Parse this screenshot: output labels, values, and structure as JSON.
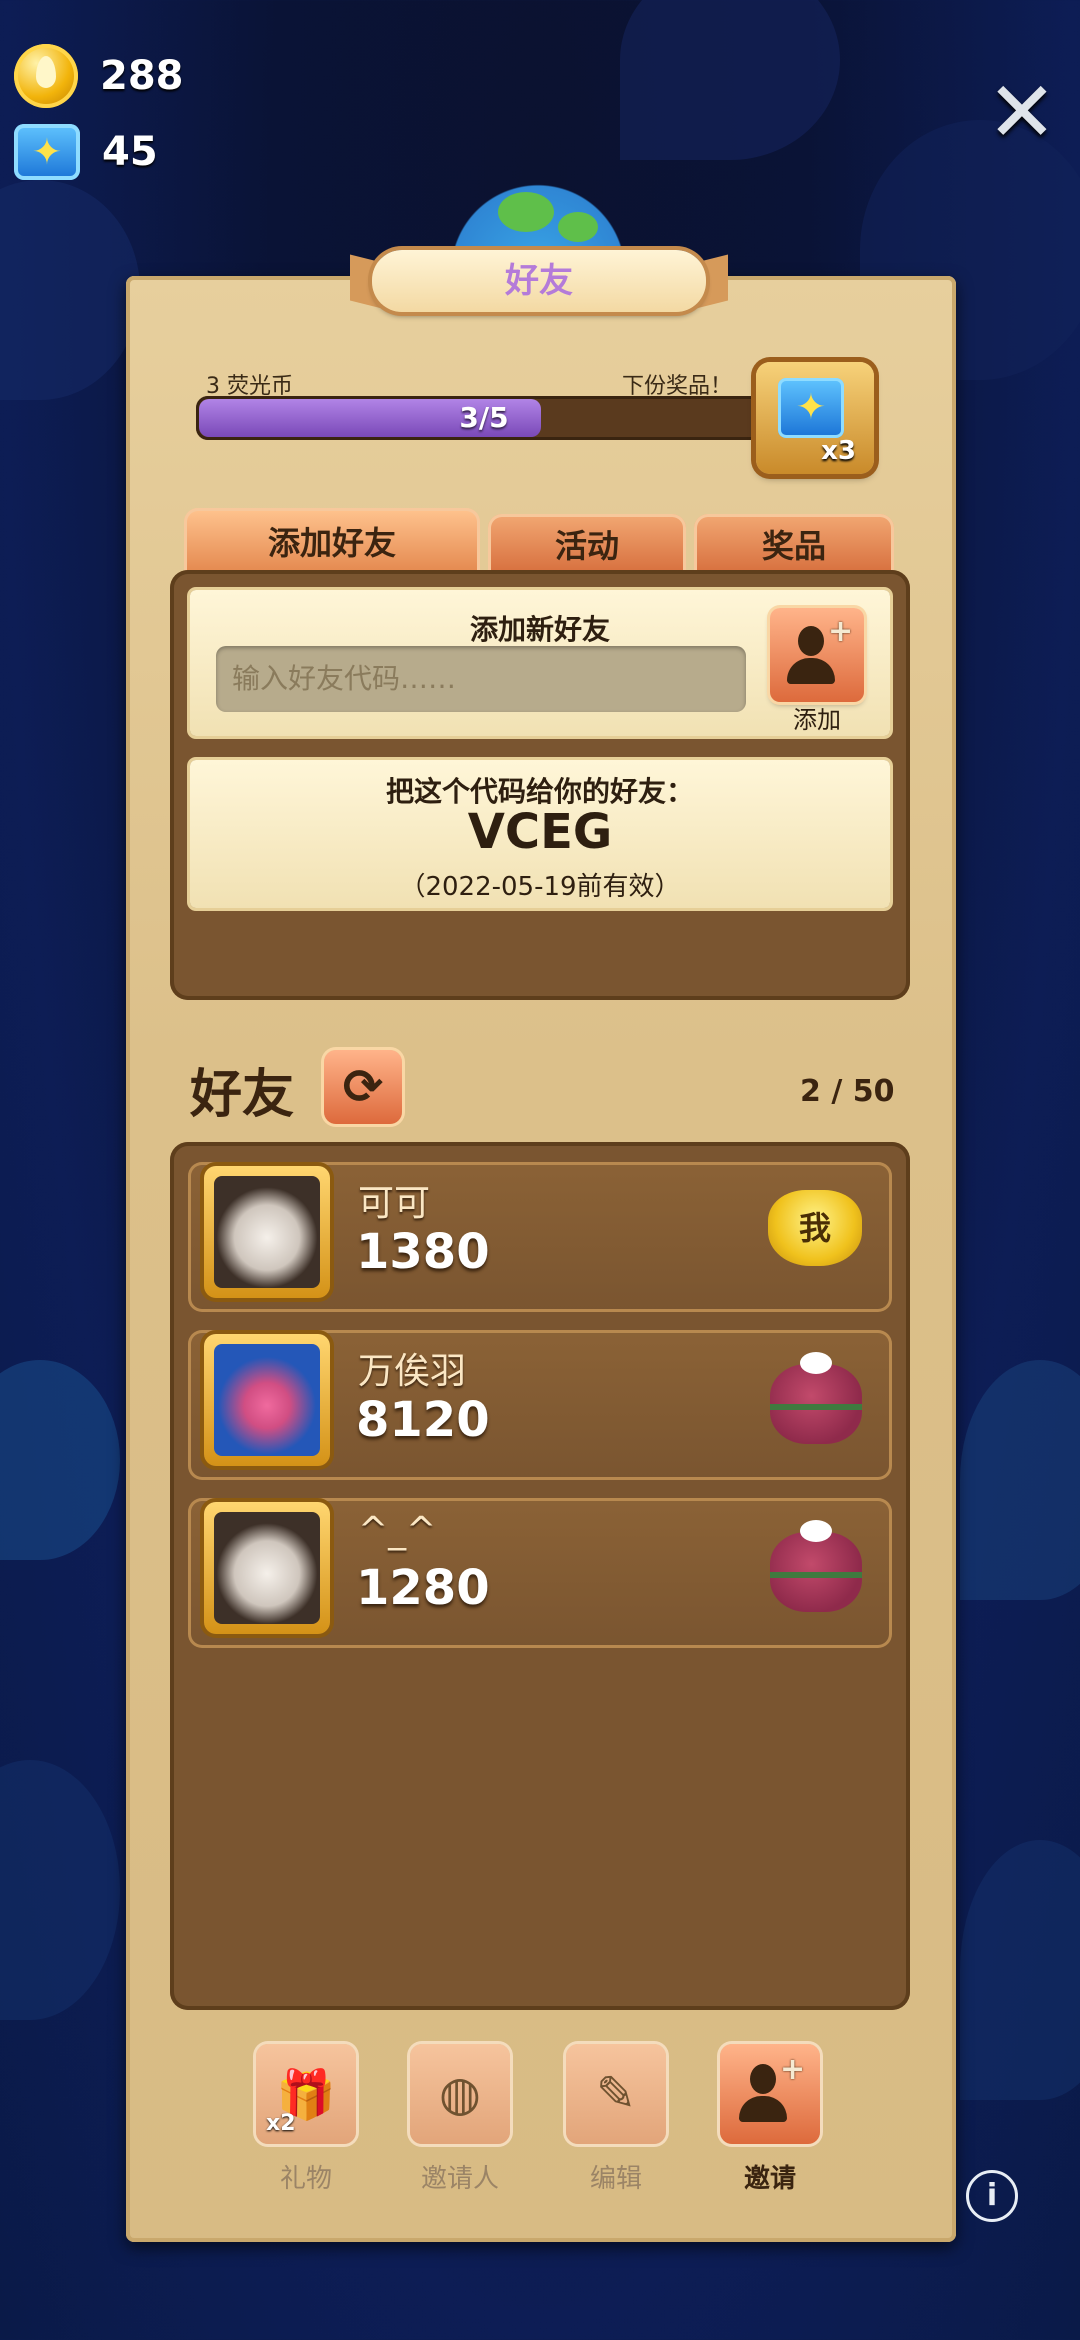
{
  "hud": {
    "drops": "288",
    "drops_icon": "drop-coin-icon",
    "butterflies": "45",
    "butterflies_icon": "butterfly-gem-icon"
  },
  "close_icon": "close-icon",
  "title": "好友",
  "progress": {
    "left_label": "3 荧光币",
    "right_label": "下份奖品！",
    "current": 3,
    "total": 5,
    "text": "3/5",
    "reward_multiplier": "x3"
  },
  "tabs": [
    {
      "label": "添加好友",
      "active": true
    },
    {
      "label": "活动",
      "active": false
    },
    {
      "label": "奖品",
      "active": false
    }
  ],
  "add_friend": {
    "title": "添加新好友",
    "input_placeholder": "输入好友代码……",
    "add_button_label": "添加"
  },
  "my_code": {
    "title": "把这个代码给你的好友：",
    "code": "VCEG",
    "validity": "（2022-05-19前有效）"
  },
  "friends": {
    "heading": "好友",
    "count": "2 / 50",
    "list": [
      {
        "name": "可可",
        "score": "1380",
        "action": "我",
        "avatar": "cat-avatar"
      },
      {
        "name": "万俟羽",
        "score": "8120",
        "action": "gift",
        "avatar": "bird-avatar"
      },
      {
        "name": "^_^",
        "score": "1280",
        "action": "gift",
        "avatar": "cat-avatar"
      }
    ]
  },
  "bottom_nav": [
    {
      "label": "礼物",
      "icon": "gift-icon",
      "badge": "x2",
      "active": false
    },
    {
      "label": "邀请人",
      "icon": "globe-icon",
      "active": false
    },
    {
      "label": "编辑",
      "icon": "pencil-icon",
      "active": false
    },
    {
      "label": "邀请",
      "icon": "add-person-icon",
      "active": true
    }
  ],
  "info_icon": "info-icon"
}
